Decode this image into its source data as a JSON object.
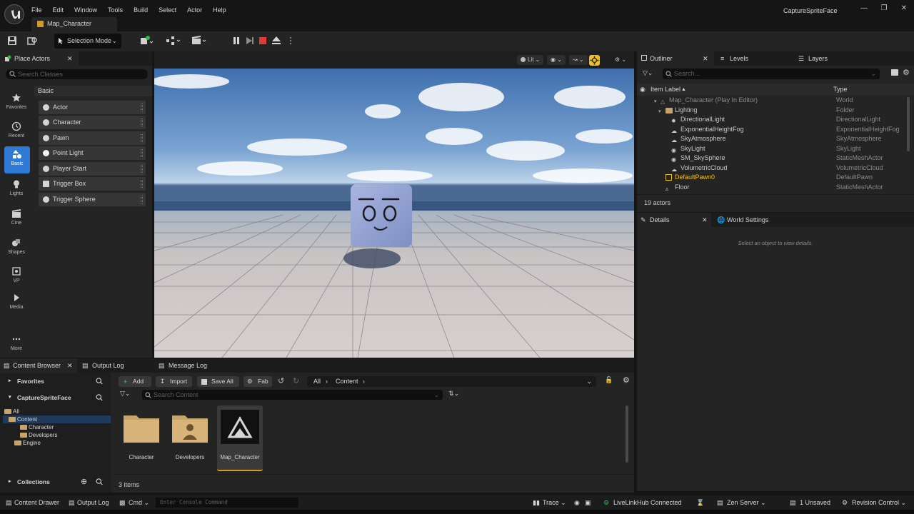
{
  "app": {
    "project_title": "CaptureSpriteFace",
    "map_tab": "Map_Character",
    "menu": [
      "File",
      "Edit",
      "Window",
      "Tools",
      "Build",
      "Select",
      "Actor",
      "Help"
    ]
  },
  "toolbar": {
    "selection_mode": "Selection Mode"
  },
  "place_actors": {
    "tab_label": "Place Actors",
    "search_placeholder": "Search Classes",
    "categories": [
      "Favorites",
      "Recent",
      "Basic",
      "Lights",
      "Cine",
      "Shapes",
      "VP",
      "Media",
      "More"
    ],
    "active_category": "Basic",
    "section_header": "Basic",
    "items": [
      "Actor",
      "Character",
      "Pawn",
      "Point Light",
      "Player Start",
      "Trigger Box",
      "Trigger Sphere"
    ]
  },
  "viewport": {
    "lit_label": "Lit"
  },
  "outliner": {
    "tabs": [
      "Outliner",
      "Levels",
      "Layers"
    ],
    "search_placeholder": "Search...",
    "col_label": "Item Label",
    "col_type": "Type",
    "rows": [
      {
        "label": "Map_Character (Play In Editor)",
        "type": "World"
      },
      {
        "label": "Lighting",
        "type": "Folder"
      },
      {
        "label": "DirectionalLight",
        "type": "DirectionalLight"
      },
      {
        "label": "ExponentialHeightFog",
        "type": "ExponentialHeightFog"
      },
      {
        "label": "SkyAtmosphere",
        "type": "SkyAtmosphere"
      },
      {
        "label": "SkyLight",
        "type": "SkyLight"
      },
      {
        "label": "SM_SkySphere",
        "type": "StaticMeshActor"
      },
      {
        "label": "VolumetricCloud",
        "type": "VolumetricCloud"
      },
      {
        "label": "DefaultPawn0",
        "type": "DefaultPawn"
      },
      {
        "label": "Floor",
        "type": "StaticMeshActor"
      }
    ],
    "actors_count": "19 actors"
  },
  "details": {
    "tabs": [
      "Details",
      "World Settings"
    ],
    "empty_message": "Select an object to view details."
  },
  "content_browser": {
    "tabs": [
      "Content Browser",
      "Output Log",
      "Message Log"
    ],
    "favorites_label": "Favorites",
    "project_label": "CaptureSpriteFace",
    "collections_label": "Collections",
    "tree": [
      "All",
      "Content",
      "Character",
      "Developers",
      "Engine"
    ],
    "buttons": {
      "add": "Add",
      "import": "Import",
      "save_all": "Save All",
      "fab": "Fab"
    },
    "path": [
      "All",
      "Content"
    ],
    "search_placeholder": "Search Content",
    "assets": [
      "Character",
      "Developers",
      "Map_Character"
    ],
    "items_count": "3 items"
  },
  "statusbar": {
    "content_drawer": "Content Drawer",
    "output_log": "Output Log",
    "cmd": "Cmd",
    "console_placeholder": "Enter Console Command",
    "trace": "Trace",
    "livelink": "LiveLinkHub Connected",
    "zen": "Zen Server",
    "unsaved": "1 Unsaved",
    "revision": "Revision Control"
  },
  "colors": {
    "accent_blue": "#2d7bd4",
    "play_red": "#e03a3a",
    "folder_tan": "#c9a46a",
    "highlight_yellow": "#f0c020"
  }
}
